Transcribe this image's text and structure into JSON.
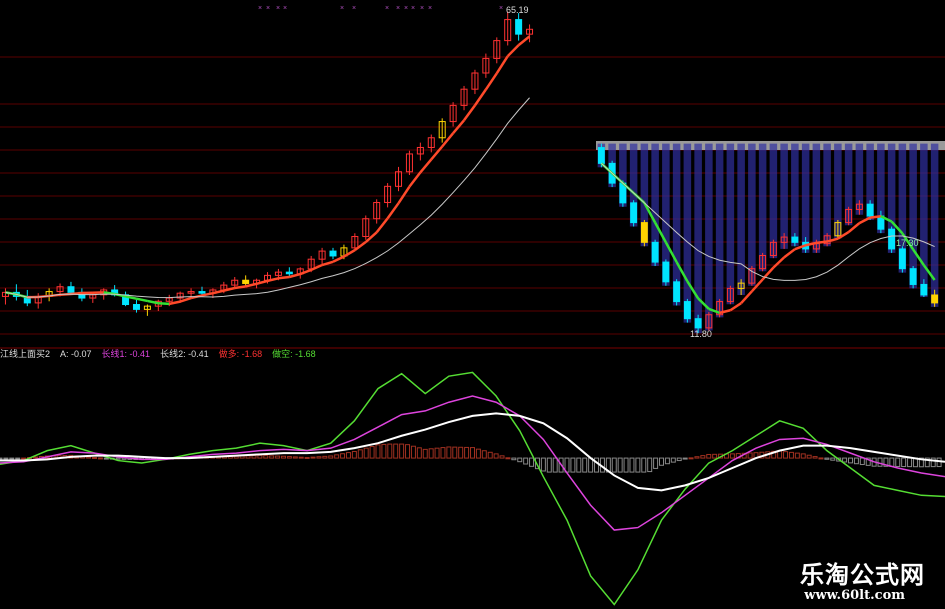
{
  "indicator_legend": {
    "name": "江线上面买2",
    "a": "A: -0.07",
    "long1": "长线1: -0.41",
    "long2": "长线2: -0.41",
    "bull": "做多: -1.68",
    "bear": "做空: -1.68"
  },
  "price_labels": {
    "high": "65.19",
    "low": "11.80",
    "mid": "17.30"
  },
  "watermark": {
    "name": "乐淘公式网",
    "url": "www.60lt.com"
  },
  "colors": {
    "up": "#ff3232",
    "down": "#00e5ff",
    "flag": "#ffd400",
    "ma_up": "#ff4a2a",
    "ma_down": "#33e033",
    "ma_slow": "#c8c8c8",
    "osc_fast": "#55dd33",
    "osc_mid": "#dd44dd",
    "osc_slow": "#ffffff",
    "band": "#3030a0",
    "grid": "#5a0000"
  },
  "chart_data": [
    {
      "type": "candlestick",
      "note": "left panel, daily OHLC",
      "candles": [
        [
          30,
          31,
          29,
          30.5
        ],
        [
          30.5,
          31.5,
          29.5,
          30
        ],
        [
          30,
          30.8,
          28.8,
          29.2
        ],
        [
          29.2,
          30.4,
          28.5,
          30
        ],
        [
          30,
          31,
          29.4,
          30.6
        ],
        [
          30.6,
          31.6,
          30,
          31.2
        ],
        [
          31.2,
          31.8,
          30.2,
          30.5
        ],
        [
          30.5,
          31,
          29.4,
          29.8
        ],
        [
          29.8,
          30.6,
          29.2,
          30.2
        ],
        [
          30.2,
          31,
          29.6,
          30.8
        ],
        [
          30.8,
          31.4,
          30,
          30.2
        ],
        [
          30.2,
          30.6,
          28.8,
          29
        ],
        [
          29,
          29.6,
          28,
          28.4
        ],
        [
          28.4,
          29,
          27.6,
          28.8
        ],
        [
          28.8,
          29.6,
          28.2,
          29.4
        ],
        [
          29.4,
          30.2,
          28.8,
          29.8
        ],
        [
          29.8,
          30.6,
          29.2,
          30.4
        ],
        [
          30.4,
          31,
          29.8,
          30.6
        ],
        [
          30.6,
          31.2,
          30,
          30.4
        ],
        [
          30.4,
          31,
          29.8,
          30.8
        ],
        [
          30.8,
          31.8,
          30.4,
          31.4
        ],
        [
          31.4,
          32.4,
          31,
          32
        ],
        [
          32,
          32.6,
          31.2,
          31.6
        ],
        [
          31.6,
          32.2,
          31,
          32
        ],
        [
          32,
          33,
          31.6,
          32.6
        ],
        [
          32.6,
          33.4,
          32,
          33
        ],
        [
          33,
          33.6,
          32.4,
          32.8
        ],
        [
          32.8,
          33.6,
          32.2,
          33.4
        ],
        [
          33.4,
          35,
          33,
          34.6
        ],
        [
          34.6,
          36,
          34,
          35.6
        ],
        [
          35.6,
          36,
          34.6,
          35
        ],
        [
          35,
          36.4,
          34.6,
          36
        ],
        [
          36,
          37.8,
          35.8,
          37.4
        ],
        [
          37.4,
          40,
          37,
          39.6
        ],
        [
          39.6,
          42,
          39,
          41.6
        ],
        [
          41.6,
          44,
          41,
          43.6
        ],
        [
          43.6,
          46,
          43,
          45.4
        ],
        [
          45.4,
          48,
          45,
          47.6
        ],
        [
          47.6,
          49,
          46.8,
          48.4
        ],
        [
          48.4,
          50,
          47.8,
          49.6
        ],
        [
          49.6,
          52,
          49,
          51.6
        ],
        [
          51.6,
          54,
          51,
          53.6
        ],
        [
          53.6,
          56,
          53,
          55.6
        ],
        [
          55.6,
          58,
          55,
          57.6
        ],
        [
          57.6,
          60,
          57,
          59.4
        ],
        [
          59.4,
          62,
          58.8,
          61.6
        ],
        [
          61.6,
          65.19,
          61,
          64.2
        ],
        [
          64.2,
          65,
          61.6,
          62.4
        ],
        [
          62.4,
          63.6,
          61.4,
          63
        ]
      ]
    },
    {
      "type": "candlestick",
      "note": "right panel, daily OHLC",
      "candles": [
        [
          40,
          40.6,
          37,
          37.6
        ],
        [
          37.6,
          38,
          34,
          34.6
        ],
        [
          34.6,
          35,
          31,
          31.6
        ],
        [
          31.6,
          32,
          28,
          28.6
        ],
        [
          28.6,
          29,
          25,
          25.6
        ],
        [
          25.6,
          26,
          22,
          22.6
        ],
        [
          22.6,
          23,
          19,
          19.6
        ],
        [
          19.6,
          20,
          16,
          16.6
        ],
        [
          16.6,
          17,
          13.4,
          14
        ],
        [
          14,
          14.6,
          11.8,
          12.6
        ],
        [
          12.6,
          15,
          12.2,
          14.6
        ],
        [
          14.6,
          17,
          14.2,
          16.6
        ],
        [
          16.6,
          19,
          16.2,
          18.6
        ],
        [
          18.6,
          20,
          17.6,
          19.4
        ],
        [
          19.4,
          22,
          19,
          21.6
        ],
        [
          21.6,
          24,
          21.2,
          23.6
        ],
        [
          23.6,
          26,
          23.2,
          25.6
        ],
        [
          25.6,
          27,
          24.6,
          26.4
        ],
        [
          26.4,
          27,
          25,
          25.6
        ],
        [
          25.6,
          26.4,
          24,
          24.6
        ],
        [
          24.6,
          26,
          24,
          25.4
        ],
        [
          25.4,
          27,
          25,
          26.6
        ],
        [
          26.6,
          29,
          26.2,
          28.6
        ],
        [
          28.6,
          31,
          28.2,
          30.6
        ],
        [
          30.6,
          32,
          29.8,
          31.4
        ],
        [
          31.4,
          32,
          29,
          29.6
        ],
        [
          29.6,
          30.4,
          27,
          27.6
        ],
        [
          27.6,
          28,
          24,
          24.6
        ],
        [
          24.6,
          25,
          21,
          21.6
        ],
        [
          21.6,
          22,
          18.6,
          19.2
        ],
        [
          19.2,
          20,
          17.3,
          17.6
        ],
        [
          17.6,
          18.4,
          15.8,
          16.4
        ]
      ]
    },
    {
      "type": "line",
      "note": "bottom oscillator panel",
      "x": [
        0,
        1,
        2,
        3,
        4,
        5,
        6,
        7,
        8,
        9,
        10,
        11,
        12,
        13,
        14,
        15,
        16,
        17,
        18,
        19,
        20,
        21,
        22,
        23,
        24,
        25,
        26,
        27,
        28,
        29,
        30,
        31,
        32,
        33,
        34,
        35,
        36,
        37,
        38,
        39,
        40
      ],
      "series": [
        {
          "values": [
            -0.5,
            -0.2,
            0.6,
            1.0,
            0.4,
            -0.2,
            -0.4,
            -0.1,
            0.3,
            0.6,
            0.8,
            1.2,
            1.0,
            0.6,
            1.2,
            3.0,
            5.6,
            6.8,
            5.2,
            6.6,
            6.9,
            5.0,
            2.2,
            -1.5,
            -5.0,
            -9.5,
            -11.8,
            -9.0,
            -5.0,
            -2.5,
            -0.4,
            0.6,
            1.8,
            3.0,
            2.4,
            0.6,
            -0.8,
            -2.2,
            -2.6,
            -3.0,
            -3.1
          ]
        },
        {
          "values": [
            -0.4,
            -0.3,
            0.1,
            0.5,
            0.4,
            0.1,
            -0.1,
            -0.1,
            0.1,
            0.3,
            0.4,
            0.6,
            0.7,
            0.6,
            0.8,
            1.5,
            2.5,
            3.5,
            3.8,
            4.5,
            5.0,
            4.5,
            3.4,
            1.5,
            -1.2,
            -3.8,
            -5.8,
            -5.6,
            -4.4,
            -3.0,
            -1.6,
            -0.2,
            0.8,
            1.5,
            1.6,
            1.1,
            0.4,
            -0.3,
            -0.8,
            -1.2,
            -1.5
          ]
        },
        {
          "values": [
            -0.2,
            -0.2,
            -0.1,
            0.1,
            0.2,
            0.2,
            0.1,
            0.0,
            0.0,
            0.1,
            0.2,
            0.3,
            0.4,
            0.4,
            0.5,
            0.8,
            1.2,
            1.8,
            2.3,
            2.9,
            3.4,
            3.6,
            3.4,
            2.8,
            1.6,
            0.0,
            -1.4,
            -2.4,
            -2.6,
            -2.2,
            -1.6,
            -0.8,
            0.0,
            0.6,
            1.0,
            1.0,
            0.8,
            0.5,
            0.2,
            -0.1,
            -0.3
          ]
        }
      ],
      "ylim": [
        -12,
        7.5
      ]
    }
  ]
}
